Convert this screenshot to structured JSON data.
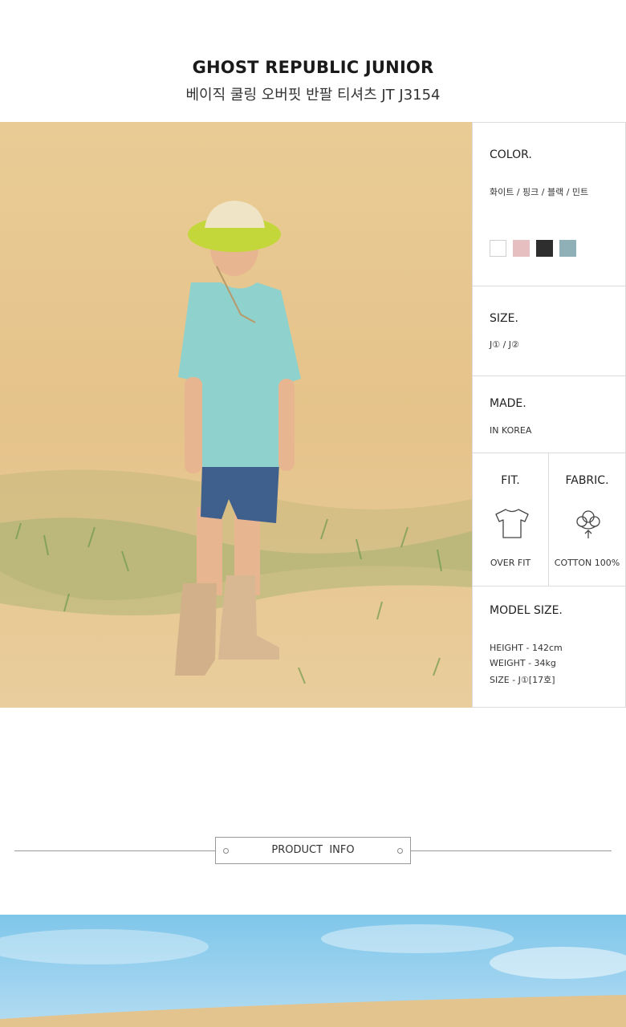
{
  "header": {
    "brand": "GHOST REPUBLIC JUNIOR",
    "product_name": "베이직 쿨링 오버핏 반팔 티셔츠 JT J3154"
  },
  "info": {
    "color": {
      "title": "COLOR.",
      "options_text": "화이트 / 핑크 / 블랙 / 민트",
      "swatches": [
        "#ffffff",
        "#e6c0c1",
        "#2e2e2e",
        "#8fb0b7"
      ]
    },
    "size": {
      "title": "SIZE.",
      "value": "J① / J②"
    },
    "made": {
      "title": "MADE.",
      "value": "IN KOREA"
    },
    "fit": {
      "title": "FIT.",
      "value": "OVER FIT",
      "icon": "tshirt-icon"
    },
    "fabric": {
      "title": "FABRIC.",
      "value": "COTTON 100%",
      "icon": "cotton-icon"
    },
    "model": {
      "title": "MODEL SIZE.",
      "height": "HEIGHT - 142cm",
      "weight": "WEIGHT - 34kg",
      "size": "SIZE - J①[17호]"
    }
  },
  "section_header": {
    "label": "PRODUCT  INFO"
  }
}
